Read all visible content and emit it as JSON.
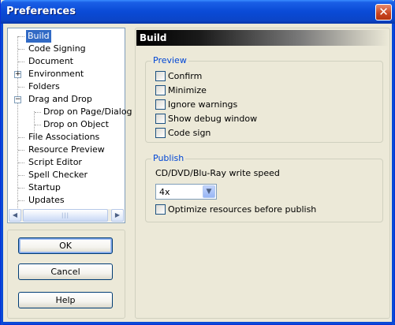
{
  "window": {
    "title": "Preferences",
    "close_glyph": "✕"
  },
  "tree": {
    "items": [
      {
        "label": "Build",
        "selected": true
      },
      {
        "label": "Code Signing"
      },
      {
        "label": "Document"
      },
      {
        "label": "Environment",
        "expander": "+"
      },
      {
        "label": "Folders"
      },
      {
        "label": "Drag and Drop",
        "expander": "−"
      },
      {
        "label": "Drop on Page/Dialog"
      },
      {
        "label": "Drop on Object"
      },
      {
        "label": "File Associations"
      },
      {
        "label": "Resource Preview"
      },
      {
        "label": "Script Editor"
      },
      {
        "label": "Spell Checker"
      },
      {
        "label": "Startup"
      },
      {
        "label": "Updates"
      }
    ],
    "scroll_left_glyph": "◀",
    "scroll_right_glyph": "▶",
    "thumb_grip": "|||"
  },
  "buttons": {
    "ok": "OK",
    "cancel": "Cancel",
    "help": "Help"
  },
  "panel": {
    "header": "Build",
    "preview": {
      "label": "Preview",
      "options": [
        {
          "label": "Confirm",
          "checked": false
        },
        {
          "label": "Minimize",
          "checked": false
        },
        {
          "label": "Ignore warnings",
          "checked": false
        },
        {
          "label": "Show debug window",
          "checked": false
        },
        {
          "label": "Code sign",
          "checked": false
        }
      ]
    },
    "publish": {
      "label": "Publish",
      "speed_label": "CD/DVD/Blu-Ray write speed",
      "speed_value": "4x",
      "optimize_label": "Optimize resources before publish",
      "optimize_checked": false
    }
  },
  "colors": {
    "titlebar": "#0a4ad6",
    "selection": "#316ac5",
    "group_label": "#0046d5"
  }
}
